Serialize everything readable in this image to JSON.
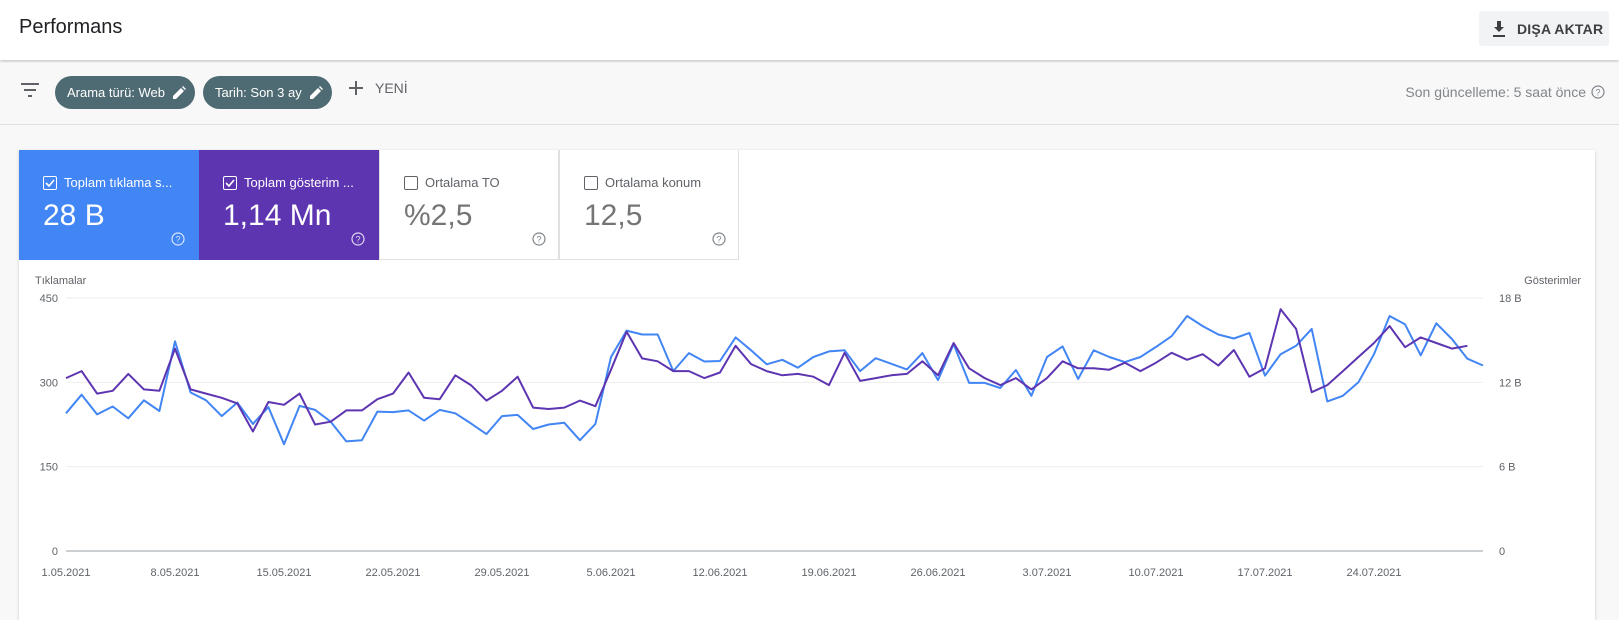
{
  "header": {
    "title": "Performans",
    "export_label": "DIŞA AKTAR"
  },
  "filters": {
    "chips": [
      {
        "label": "Arama türü: Web"
      },
      {
        "label": "Tarih: Son 3 ay"
      }
    ],
    "new_label": "YENİ",
    "last_update": "Son güncelleme: 5 saat önce"
  },
  "metrics": [
    {
      "label": "Toplam tıklama s...",
      "value": "28 B",
      "checked": true,
      "color": "#4285f4"
    },
    {
      "label": "Toplam gösterim ...",
      "value": "1,14 Mn",
      "checked": true,
      "color": "#5e35b1"
    },
    {
      "label": "Ortalama TO",
      "value": "%2,5",
      "checked": false
    },
    {
      "label": "Ortalama konum",
      "value": "12,5",
      "checked": false
    }
  ],
  "chart_data": {
    "type": "line",
    "ylabel_left": "Tıklamalar",
    "ylabel_right": "Gösterimler",
    "yticks_left": [
      "0",
      "150",
      "300",
      "450"
    ],
    "yticks_right": [
      "0",
      "6 B",
      "12 B",
      "18 B"
    ],
    "ylim_left": [
      0,
      450
    ],
    "ylim_right": [
      0,
      18000
    ],
    "x_tick_labels": [
      "1.05.2021",
      "8.05.2021",
      "15.05.2021",
      "22.05.2021",
      "29.05.2021",
      "5.06.2021",
      "12.06.2021",
      "19.06.2021",
      "26.06.2021",
      "3.07.2021",
      "10.07.2021",
      "17.07.2021",
      "24.07.2021"
    ],
    "start_date": "2021-05-01",
    "grid": true,
    "series": [
      {
        "axis": "left",
        "color": "#4285f4",
        "values": [
          245,
          278,
          243,
          257,
          236,
          268,
          249,
          373,
          282,
          268,
          240,
          264,
          226,
          256,
          190,
          258,
          251,
          230,
          195,
          197,
          248,
          247,
          250,
          232,
          251,
          245,
          227,
          208,
          240,
          242,
          217,
          225,
          228,
          197,
          226,
          345,
          392,
          385,
          385,
          320,
          352,
          337,
          338,
          380,
          357,
          332,
          340,
          326,
          345,
          355,
          357,
          320,
          343,
          333,
          323,
          352,
          304,
          368,
          299,
          299,
          290,
          322,
          276,
          345,
          364,
          306,
          357,
          345,
          336,
          345,
          363,
          382,
          418,
          400,
          385,
          378,
          388,
          312,
          350,
          365,
          395,
          266,
          276,
          300,
          350,
          418,
          403,
          348,
          405,
          377,
          342,
          330
        ]
      },
      {
        "axis": "right",
        "color": "#5e35b1",
        "values": [
          12300,
          12800,
          11200,
          11400,
          12600,
          11500,
          11400,
          14400,
          11500,
          11200,
          10900,
          10500,
          8500,
          10600,
          10400,
          11200,
          9000,
          9200,
          10000,
          10000,
          10800,
          11200,
          12700,
          10900,
          10800,
          12500,
          11800,
          10700,
          11400,
          12400,
          10200,
          10100,
          10200,
          10700,
          10300,
          12900,
          15600,
          13700,
          13500,
          12800,
          12800,
          12300,
          12700,
          14600,
          13300,
          12800,
          12500,
          12600,
          12400,
          11800,
          14100,
          12100,
          12300,
          12500,
          12600,
          13500,
          12500,
          14800,
          13000,
          12300,
          11800,
          12300,
          11500,
          12300,
          13500,
          13000,
          13000,
          12900,
          13400,
          12800,
          13400,
          14100,
          13600,
          14000,
          13200,
          14300,
          12400,
          13000,
          17200,
          15800,
          11300,
          11800,
          12800,
          13800,
          14800,
          16000,
          14500,
          15200,
          14800,
          14400,
          14600
        ]
      }
    ]
  }
}
